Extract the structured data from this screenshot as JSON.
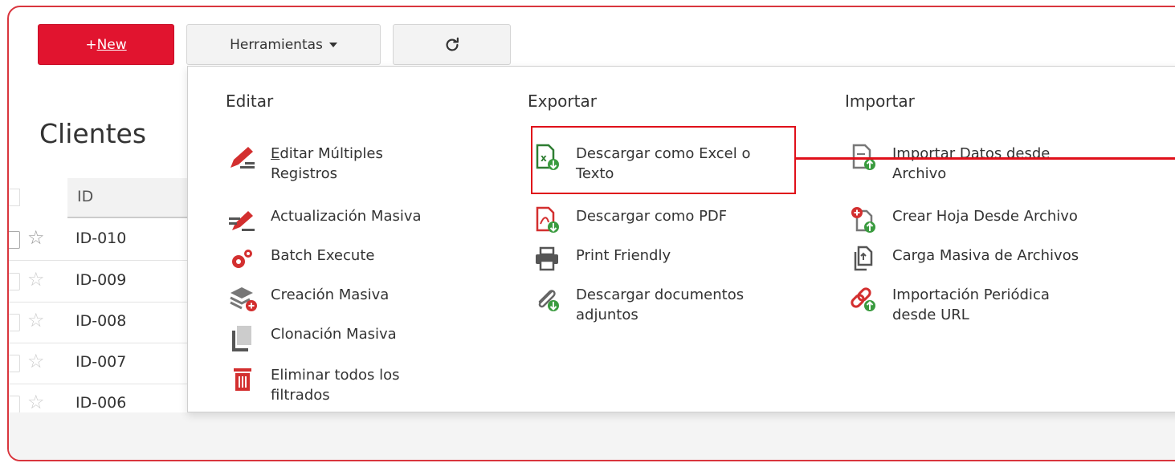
{
  "toolbar": {
    "new_prefix": "+",
    "new_label": "New",
    "tools_label": "Herramientas",
    "refresh_icon": "refresh-icon"
  },
  "page": {
    "title": "Clientes"
  },
  "list": {
    "column_id": "ID",
    "rows": [
      {
        "id": "ID-010"
      },
      {
        "id": "ID-009"
      },
      {
        "id": "ID-008"
      },
      {
        "id": "ID-007"
      },
      {
        "id": "ID-006"
      }
    ]
  },
  "menu": {
    "editar": {
      "heading": "Editar",
      "items": [
        {
          "label_line1": "Editar Múltiples",
          "label_line2": "Registros",
          "icon": "edit-pencil-icon"
        },
        {
          "label_line1": "Actualización Masiva",
          "icon": "mass-update-icon"
        },
        {
          "label_line1": "Batch Execute",
          "icon": "gears-icon"
        },
        {
          "label_line1": "Creación Masiva",
          "icon": "layers-add-icon"
        },
        {
          "label_line1": "Clonación Masiva",
          "icon": "copy-icon"
        },
        {
          "label_line1": "Eliminar todos los",
          "label_line2": "filtrados",
          "icon": "trash-icon"
        }
      ]
    },
    "exportar": {
      "heading": "Exportar",
      "items": [
        {
          "label_line1": "Descargar como Excel o",
          "label_line2": "Texto",
          "icon": "excel-download-icon"
        },
        {
          "label_line1": "Descargar como PDF",
          "icon": "pdf-download-icon"
        },
        {
          "label_line1": "Print Friendly",
          "icon": "printer-icon"
        },
        {
          "label_line1": "Descargar documentos",
          "label_line2": "adjuntos",
          "icon": "paperclip-download-icon"
        }
      ]
    },
    "importar": {
      "heading": "Importar",
      "items": [
        {
          "label_line1": "Importar Datos desde",
          "label_line2": "Archivo",
          "icon": "file-upload-icon"
        },
        {
          "label_line1": "Crear Hoja Desde Archivo",
          "icon": "sheet-add-icon"
        },
        {
          "label_line1": "Carga Masiva de Archivos",
          "icon": "files-upload-icon"
        },
        {
          "label_line1": "Importación Periódica",
          "label_line2": "desde URL",
          "icon": "link-upload-icon"
        }
      ]
    }
  },
  "colors": {
    "accent": "#e1142f",
    "highlight": "#e0101a",
    "icon_red": "#d32f2f",
    "icon_green": "#2e8b3a",
    "icon_gray": "#555555"
  }
}
